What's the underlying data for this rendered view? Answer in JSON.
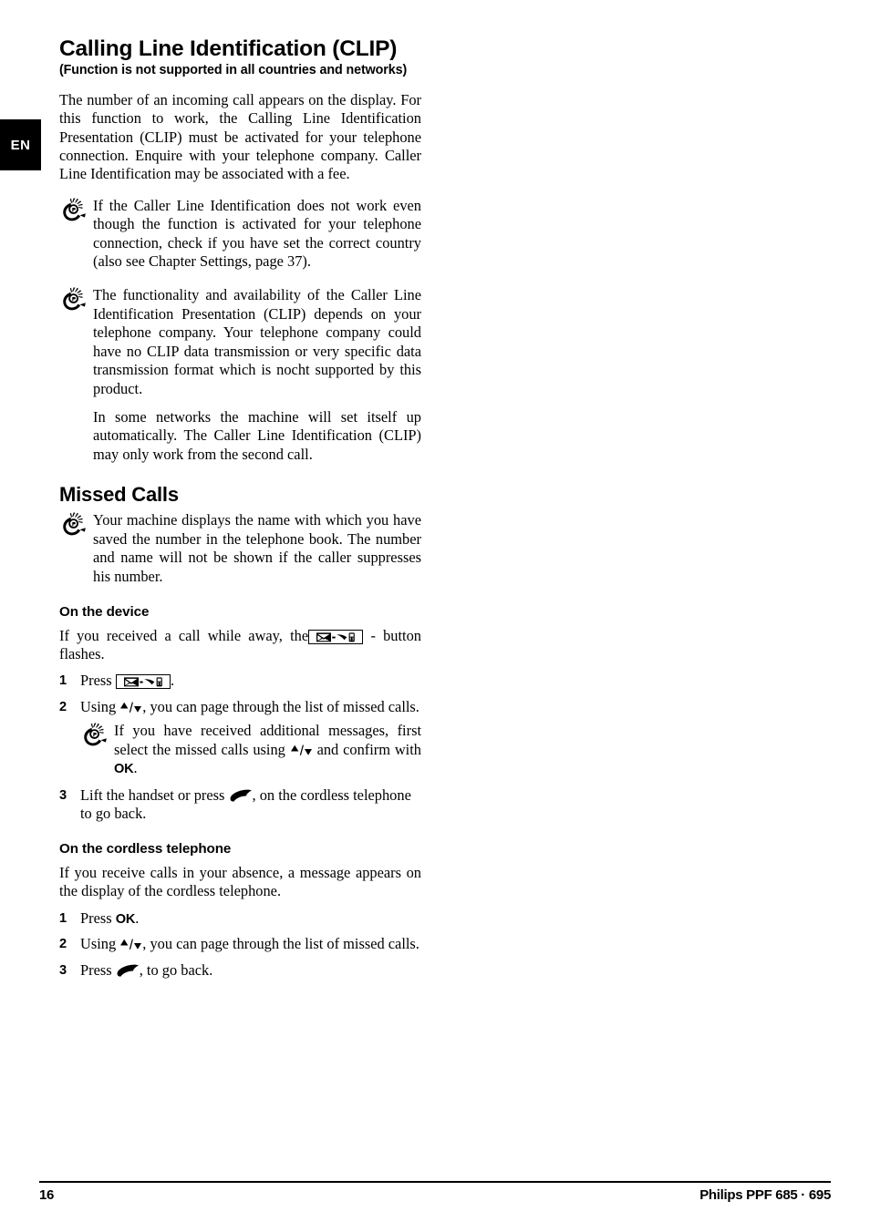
{
  "language_tab": {
    "label": "EN"
  },
  "chapter": {
    "title": "Calling Line Identification (CLIP)",
    "subtitle": "(Function is not supported in all countries and networks)",
    "intro": "The number of an incoming call appears on the display. For this function to work, the Calling Line Identification Presentation (CLIP) must be activated for your telephone connection. Enquire with your telephone company. Caller Line Identification may be associated with a fee.",
    "tips": [
      {
        "icon": "hint-hand-bulb-icon",
        "text": "If the Caller Line Identification does not work even though the function is activated for your telephone connection, check if you have set the correct country (also see Chapter Settings, page 37)."
      },
      {
        "icon": "hint-hand-bulb-icon",
        "text": "The functionality and availability of the Caller Line Identification Presentation (CLIP) depends on your telephone company. Your telephone company could have no CLIP data transmission or very specific data transmission format which is nocht supported by this product."
      }
    ],
    "tip_continuation": "In some networks the machine will set itself up automatically. The Caller Line Identification (CLIP) may only work from the second call."
  },
  "missed_calls": {
    "title": "Missed Calls",
    "tip": {
      "icon": "hint-hand-bulb-icon",
      "text": "Your machine displays the name with which you have saved the number in the telephone book. The number and name will not be shown if the caller suppresses his number."
    },
    "on_the_device": {
      "title": "On the device",
      "intro_before": "If you received a call while away, the",
      "intro_button_icon": "missed-calls-button-icon",
      "intro_after": "- button flashes.",
      "steps": [
        {
          "number": "1",
          "before": "Press",
          "button_icon": "missed-calls-button-icon",
          "after": ".",
          "tip": null
        },
        {
          "number": "2",
          "before": "Using",
          "nav_icon": "up-down-arrows-icon",
          "after": ", you can page through the list of missed calls.",
          "tip": {
            "icon": "hint-hand-bulb-icon",
            "before": "If you have received additional messages, first select the missed calls using",
            "nav_icon": "up-down-arrows-icon",
            "middle": "and confirm with",
            "key": "OK",
            "after": "."
          }
        },
        {
          "number": "3",
          "before": "Lift the handset or press",
          "handset_icon": "handset-pickup-icon",
          "after": ", on the cordless telephone to go back.",
          "tip": null
        }
      ]
    },
    "on_the_cordless_telephone": {
      "title": "On the cordless telephone",
      "intro": "If you receive calls in your absence, a message appears on the display of the cordless telephone.",
      "steps": [
        {
          "number": "1",
          "before": "Press",
          "key": "OK",
          "after": "."
        },
        {
          "number": "2",
          "before": "Using",
          "nav_icon": "up-down-arrows-icon",
          "after": ", you can page through the list of missed calls."
        },
        {
          "number": "3",
          "before": "Press",
          "handset_icon": "handset-pickup-icon",
          "after": ", to go back."
        }
      ]
    }
  },
  "footer": {
    "page_number": "16",
    "product": "Philips PPF 685 · 695"
  },
  "colors": {
    "text": "#000000",
    "background": "#ffffff",
    "tab_background": "#000000",
    "tab_text": "#ffffff"
  }
}
